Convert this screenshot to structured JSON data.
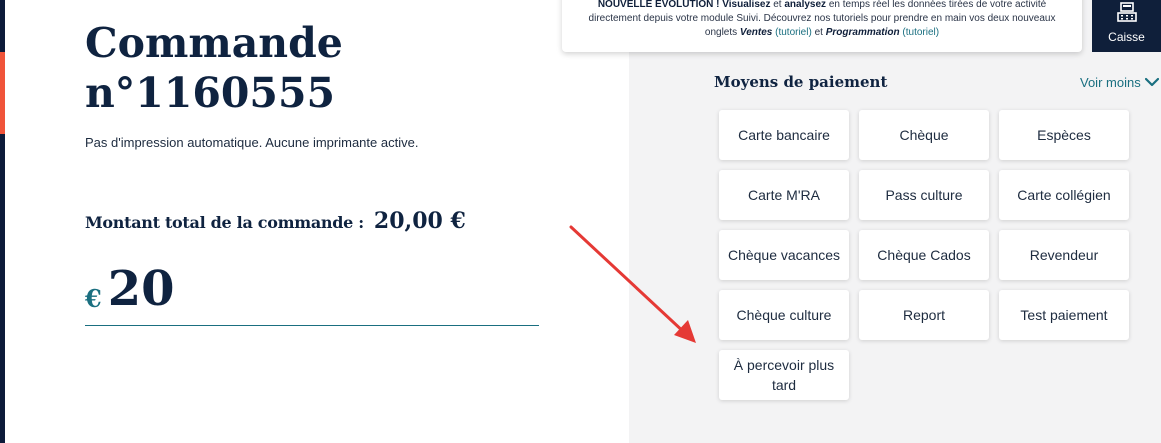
{
  "order": {
    "title": "Commande n°1160555",
    "print_note": "Pas d'impression automatique. Aucune imprimante active.",
    "total_label": "Montant total de la commande :",
    "total_value": "20,00 €",
    "currency_symbol": "€",
    "amount_value": "20"
  },
  "banner": {
    "lead": "NOUVELLE EVOLUTION !",
    "w1": "Visualisez",
    "t1": "et",
    "w2": "analysez",
    "t2": "en temps réel les données tirées de votre activité directement depuis votre module Suivi. Découvrez nos tutoriels pour prendre en main vos deux nouveaux onglets",
    "tab1": "Ventes",
    "tut1": "(tutoriel)",
    "t3": "et",
    "tab2": "Programmation",
    "tut2": "(tutoriel)"
  },
  "caisse": {
    "label": "Caisse",
    "icon": "cash-register-icon"
  },
  "payment": {
    "title": "Moyens de paiement",
    "toggle_label": "Voir moins",
    "methods": [
      "Carte bancaire",
      "Chèque",
      "Espèces",
      "Carte M'RA",
      "Pass culture",
      "Carte collégien",
      "Chèque vacances",
      "Chèque Cados",
      "Revendeur",
      "Chèque culture",
      "Report",
      "Test paiement",
      "À percevoir plus tard"
    ]
  },
  "colors": {
    "navy": "#0f2340",
    "teal": "#1a6f80",
    "accent": "#f0543a",
    "annotation_arrow": "#e53935",
    "panel_bg": "#f3f3f4"
  }
}
